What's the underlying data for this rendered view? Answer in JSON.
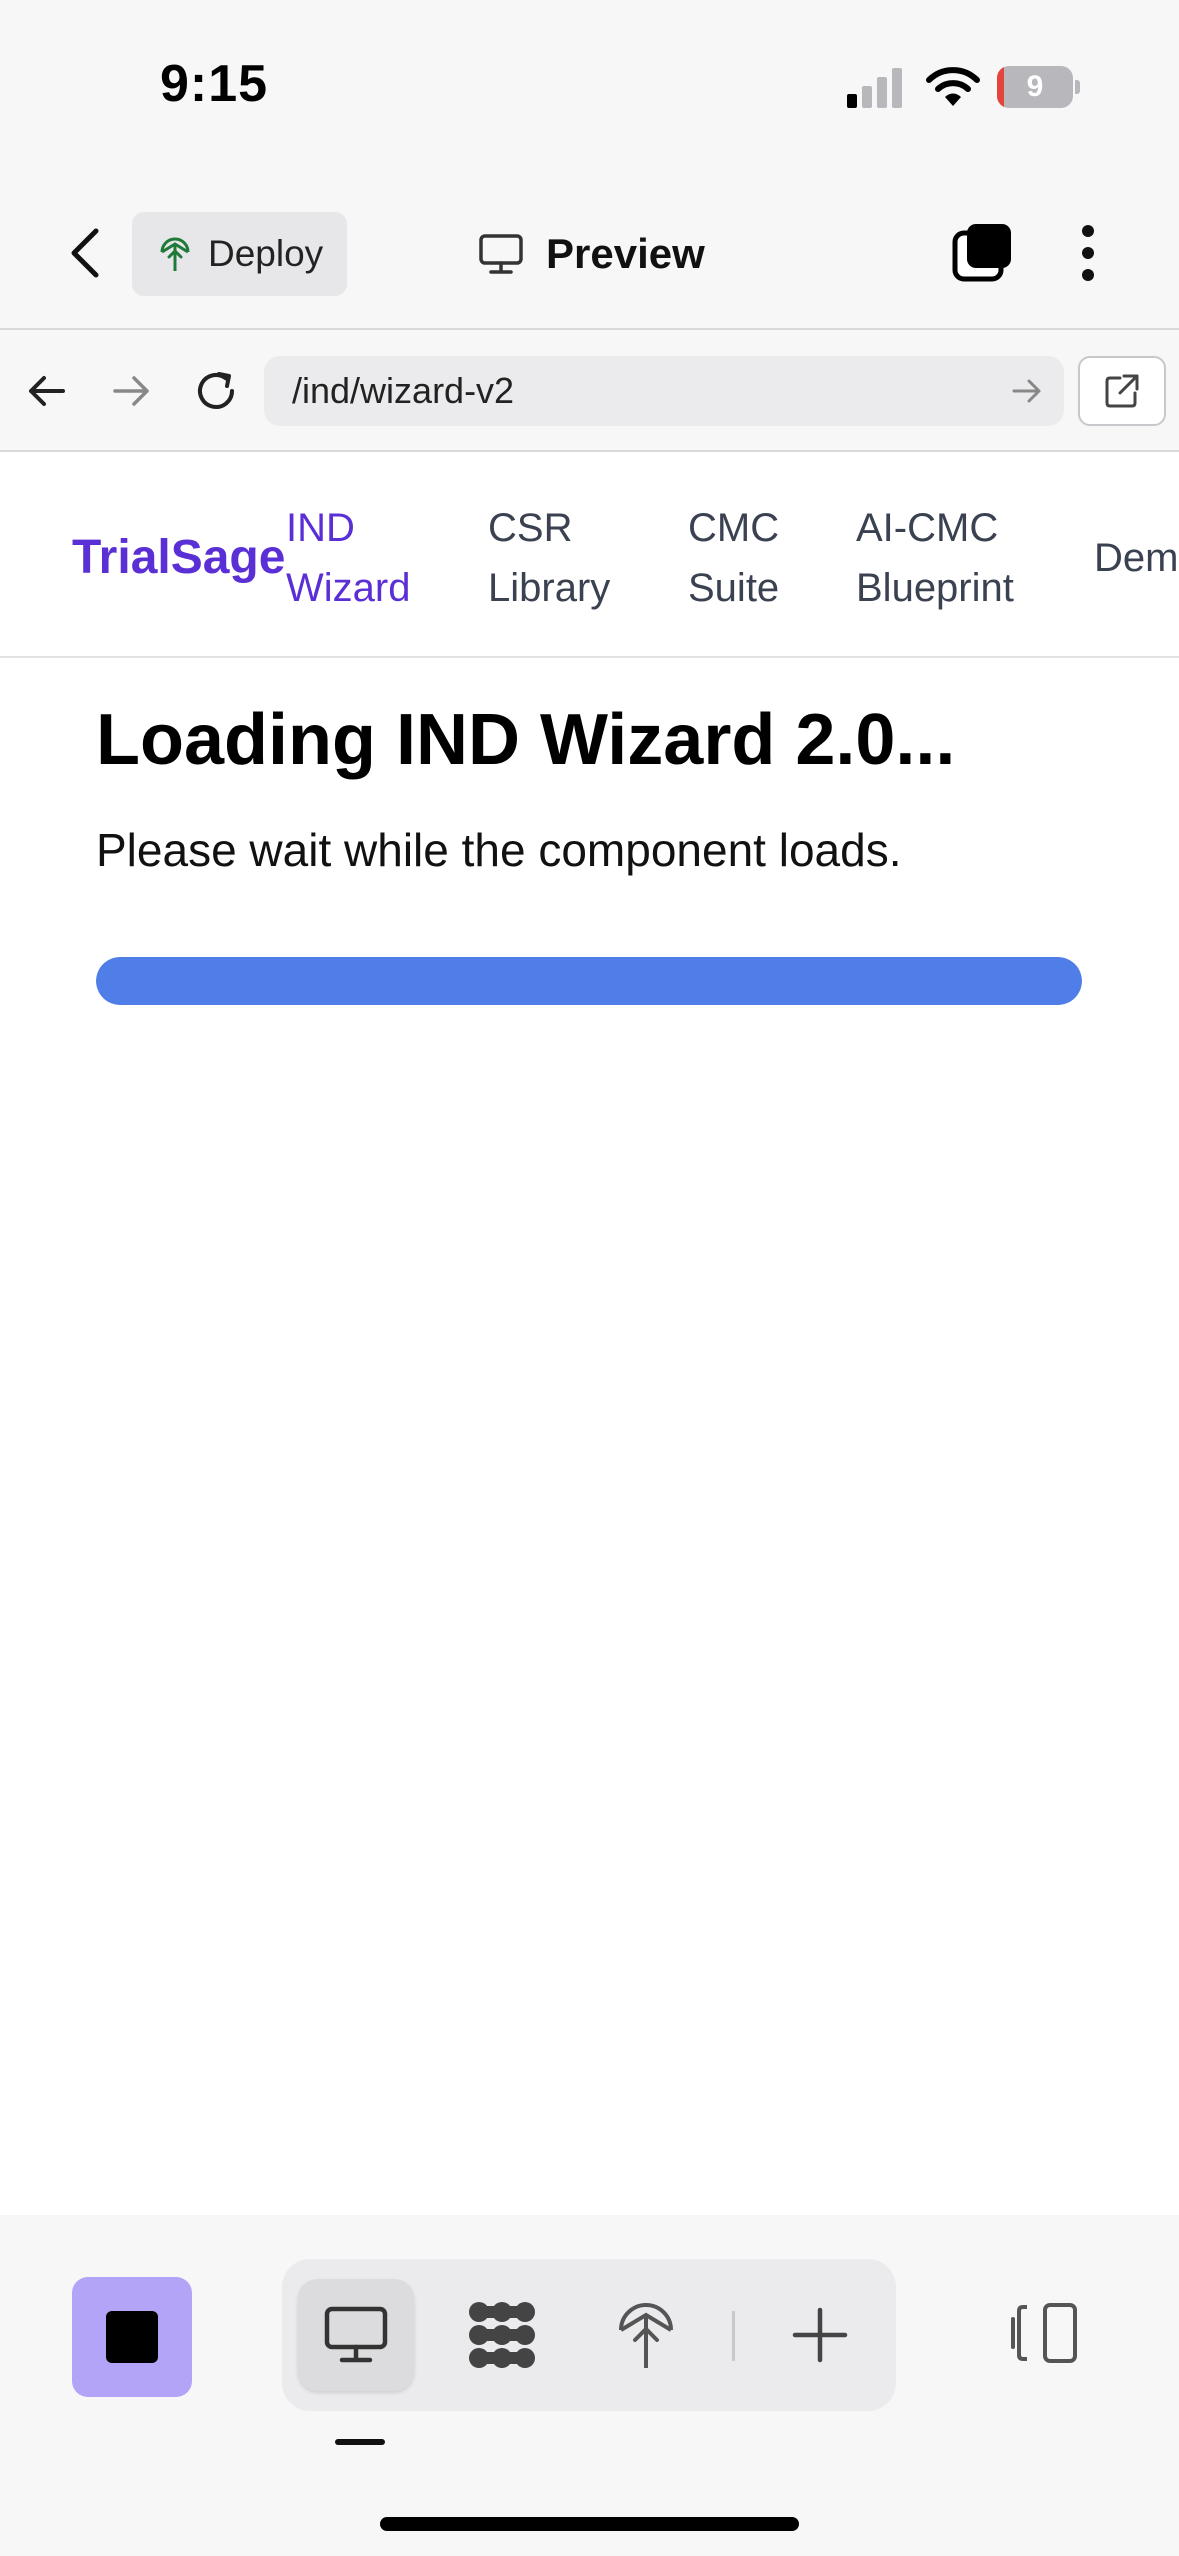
{
  "status_bar": {
    "time": "9:15",
    "battery_level": "9",
    "battery_fraction": 0.09,
    "signal_bars_active": 1
  },
  "app_toolbar": {
    "deploy_label": "Deploy",
    "preview_label": "Preview",
    "icons": [
      "chevron-left-icon",
      "deploy-icon",
      "monitor-icon",
      "tabs-icon",
      "more-vertical-icon"
    ]
  },
  "browser": {
    "url": "/ind/wizard-v2",
    "icons": [
      "arrow-left-icon",
      "arrow-right-icon",
      "reload-icon",
      "url-go-icon",
      "external-link-icon"
    ]
  },
  "site_nav": {
    "brand": "TrialSage",
    "items": [
      {
        "line1": "IND",
        "line2": "Wizard",
        "active": true
      },
      {
        "line1": "CSR",
        "line2": "Library",
        "active": false
      },
      {
        "line1": "CMC",
        "line2": "Suite",
        "active": false
      },
      {
        "line1": "AI-CMC",
        "line2": "Blueprint",
        "active": false
      },
      {
        "line1": "Dem",
        "line2": "",
        "active": false
      }
    ]
  },
  "main": {
    "title": "Loading IND Wizard 2.0...",
    "message": "Please wait while the component loads.",
    "progress_fraction": 1.0
  },
  "bottom_toolbar": {
    "icons": [
      "stop-icon",
      "monitor-icon",
      "workflow-icon",
      "deploy-icon",
      "plus-icon",
      "panel-toggle-icon"
    ],
    "selected": "monitor-icon"
  },
  "colors": {
    "brand": "#5b2fd6",
    "progress": "#4f7ee8",
    "stop_button": "#b3a4f7",
    "battery_low": "#e5443c"
  }
}
